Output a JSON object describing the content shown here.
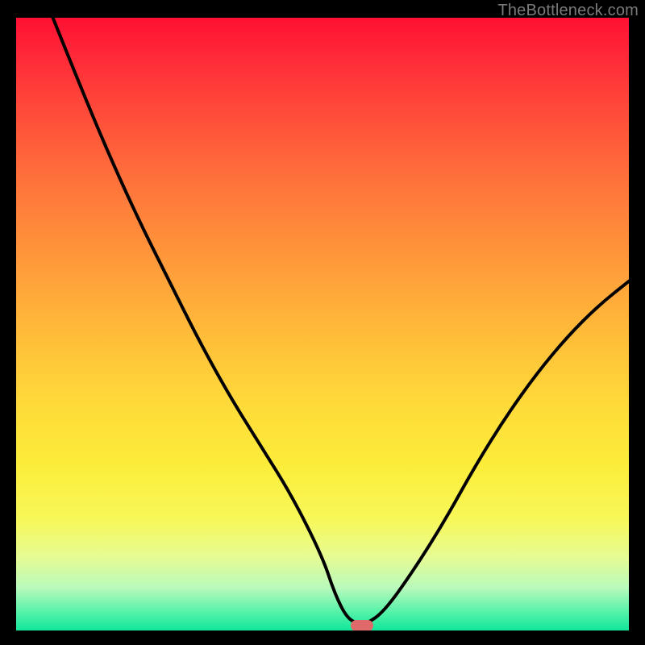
{
  "watermark": "TheBottleneck.com",
  "colors": {
    "background": "#000000",
    "curve_stroke": "#000000",
    "marker_fill": "#e06a6a",
    "watermark_text": "#7a7a7a"
  },
  "chart_data": {
    "type": "line",
    "title": "",
    "xlabel": "",
    "ylabel": "",
    "xlim": [
      0,
      100
    ],
    "ylim": [
      0,
      100
    ],
    "grid": false,
    "series": [
      {
        "name": "curve",
        "x": [
          6,
          10,
          15,
          20,
          25,
          30,
          35,
          40,
          45,
          50,
          52,
          54,
          56,
          57,
          60,
          65,
          70,
          75,
          80,
          85,
          90,
          95,
          100
        ],
        "y": [
          100,
          90,
          78,
          67,
          57,
          47,
          38,
          30,
          22,
          12,
          6,
          2,
          1,
          1,
          3,
          10,
          18,
          27,
          35,
          42,
          48,
          53,
          57
        ]
      }
    ],
    "marker": {
      "x": 56.5,
      "y": 0.8
    },
    "gradient_stops": [
      {
        "pos": 0.0,
        "color": "#ff1033"
      },
      {
        "pos": 0.27,
        "color": "#ff733b"
      },
      {
        "pos": 0.63,
        "color": "#ffda39"
      },
      {
        "pos": 0.88,
        "color": "#e6fb93"
      },
      {
        "pos": 1.0,
        "color": "#11e79b"
      }
    ]
  }
}
